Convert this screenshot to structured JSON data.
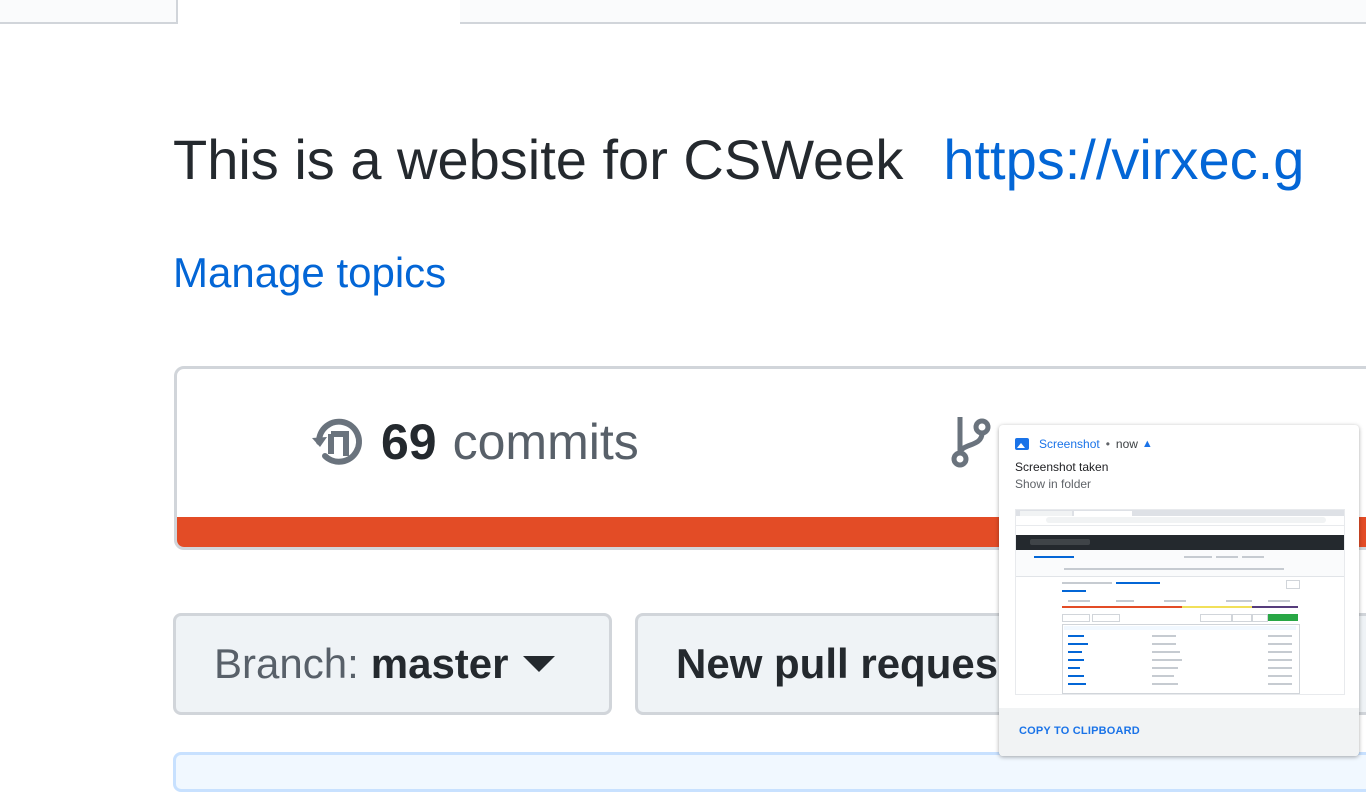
{
  "repo": {
    "description": "This is a website for CSWeek",
    "homepage": "https://virxec.g",
    "manage_topics": "Manage topics"
  },
  "summary": {
    "commits_count": "69",
    "commits_label": "commits"
  },
  "branch_button": {
    "prefix": "Branch:",
    "name": "master"
  },
  "pr_button": {
    "label": "New pull reques"
  },
  "notification": {
    "app": "Screenshot",
    "separator": "•",
    "time": "now",
    "title": "Screenshot taken",
    "subtitle": "Show in folder",
    "action": "COPY TO CLIPBOARD"
  },
  "colors": {
    "link": "#0366d6",
    "language_bar": "#e34c26",
    "notification_accent": "#1a73e8"
  },
  "icons": [
    "history-icon",
    "git-branch-icon",
    "caret-down-icon",
    "image-icon",
    "chevron-up-icon"
  ]
}
